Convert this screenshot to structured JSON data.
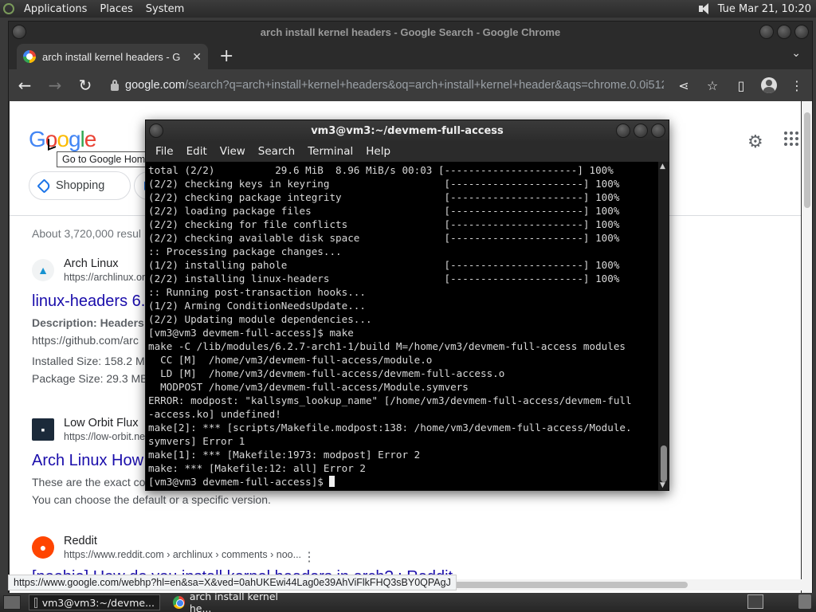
{
  "top_panel": {
    "menus": [
      "Applications",
      "Places",
      "System"
    ],
    "clock": "Tue Mar 21, 10:20"
  },
  "chrome": {
    "window_title": "arch install kernel headers - Google Search - Google Chrome",
    "tab_title": "arch install kernel headers - G",
    "address_host": "google.com",
    "address_path": "/search?q=arch+install+kernel+headers&oq=arch+install+kernel+header&aqs=chrome.0.0i512j..."
  },
  "page": {
    "logo": [
      "G",
      "o",
      "o",
      "g",
      "l",
      "e"
    ],
    "tooltip": "Go to Google Home",
    "chip_shopping": "Shopping",
    "stats": "About 3,720,000 resul",
    "results": [
      {
        "site": "Arch Linux",
        "url": "https://archlinux.or",
        "title": "linux-headers 6.",
        "lines": [
          "Description: Headers a",
          "https://github.com/arc",
          "Installed Size: 158.2 MI",
          "Package Size: 29.3 MB"
        ]
      },
      {
        "site": "Low Orbit Flux",
        "url": "https://low-orbit.ne",
        "title": "Arch Linux How",
        "lines": [
          "These are the exact co",
          "You can choose the default or a specific version."
        ]
      },
      {
        "site": "Reddit",
        "url": "https://www.reddit.com › archlinux › comments › noo...",
        "title": "[noobie] How do you install kernel headers in arch? : Reddit",
        "lines": []
      }
    ],
    "status_url": "https://www.google.com/webhp?hl=en&sa=X&ved=0ahUKEwi44Lag0e39AhViFlkFHQ3sBY0QPAgJ"
  },
  "terminal": {
    "title": "vm3@vm3:~/devmem-full-access",
    "menus": [
      "File",
      "Edit",
      "View",
      "Search",
      "Terminal",
      "Help"
    ],
    "lines": [
      "total (2/2)          29.6 MiB  8.96 MiB/s 00:03 [----------------------] 100%",
      "(2/2) checking keys in keyring                   [----------------------] 100%",
      "(2/2) checking package integrity                 [----------------------] 100%",
      "(2/2) loading package files                      [----------------------] 100%",
      "(2/2) checking for file conflicts                [----------------------] 100%",
      "(2/2) checking available disk space              [----------------------] 100%",
      ":: Processing package changes...",
      "(1/2) installing pahole                          [----------------------] 100%",
      "(2/2) installing linux-headers                   [----------------------] 100%",
      ":: Running post-transaction hooks...",
      "(1/2) Arming ConditionNeedsUpdate...",
      "(2/2) Updating module dependencies...",
      "[vm3@vm3 devmem-full-access]$ make",
      "make -C /lib/modules/6.2.7-arch1-1/build M=/home/vm3/devmem-full-access modules",
      "  CC [M]  /home/vm3/devmem-full-access/module.o",
      "  LD [M]  /home/vm3/devmem-full-access/devmem-full-access.o",
      "  MODPOST /home/vm3/devmem-full-access/Module.symvers",
      "ERROR: modpost: \"kallsyms_lookup_name\" [/home/vm3/devmem-full-access/devmem-full",
      "-access.ko] undefined!",
      "make[2]: *** [scripts/Makefile.modpost:138: /home/vm3/devmem-full-access/Module.",
      "symvers] Error 1",
      "make[1]: *** [Makefile:1973: modpost] Error 2",
      "make: *** [Makefile:12: all] Error 2"
    ],
    "prompt": "[vm3@vm3 devmem-full-access]$ "
  },
  "taskbar": {
    "items": [
      "vm3@vm3:~/devme...",
      "arch install kernel he..."
    ]
  }
}
